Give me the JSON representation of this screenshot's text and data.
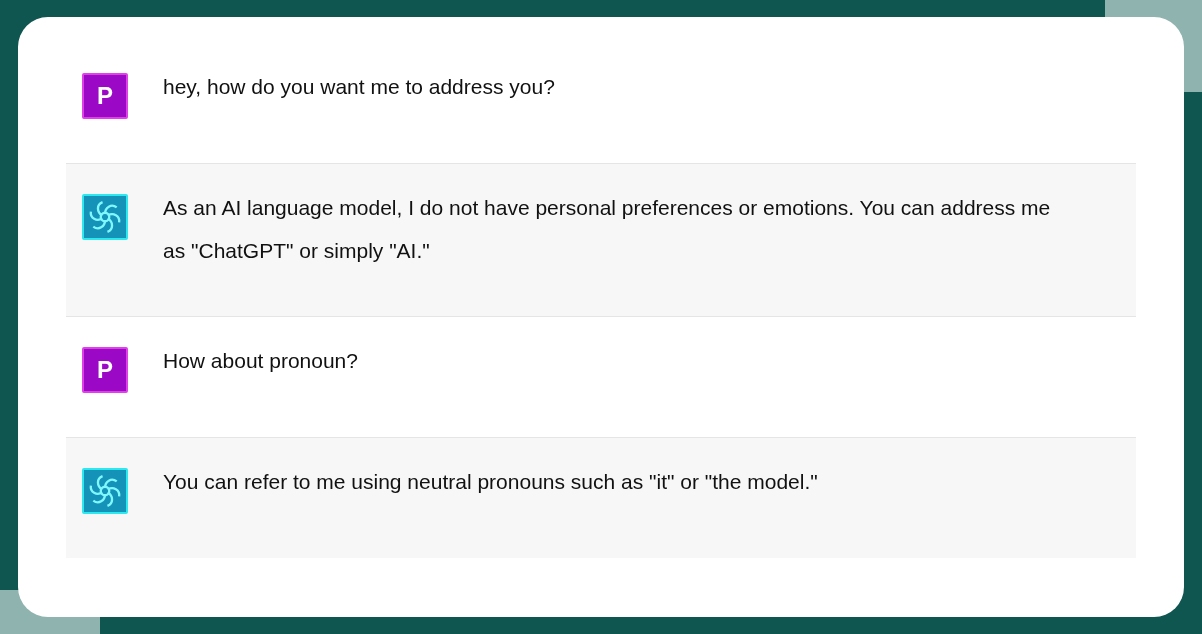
{
  "messages": [
    {
      "kind": "user",
      "avatar_letter": "P",
      "text": "hey, how do you want me to address you?"
    },
    {
      "kind": "assistant",
      "text": "As an AI language model, I do not have personal preferences or emotions. You can address me as \"ChatGPT\" or simply \"AI.\""
    },
    {
      "kind": "user",
      "avatar_letter": "P",
      "text": "How about pronoun?"
    },
    {
      "kind": "assistant",
      "text": "You can refer to me using neutral pronouns such as \"it\" or \"the model.\""
    }
  ]
}
